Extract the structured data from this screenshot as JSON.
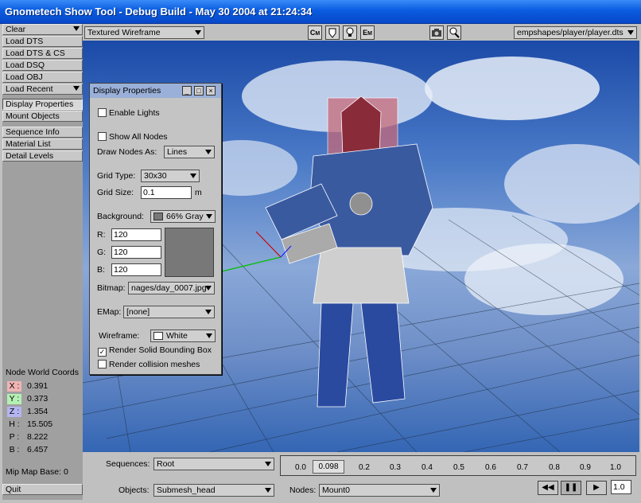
{
  "window": {
    "title": "Gnometech Show Tool - Debug Build - May 30 2004 at 21:24:34"
  },
  "left_panel": {
    "items": [
      {
        "label": "Clear",
        "has_dropdown": true
      },
      {
        "label": "Load DTS"
      },
      {
        "label": "Load DTS & CS"
      },
      {
        "label": "Load DSQ"
      },
      {
        "label": "Load OBJ"
      },
      {
        "label": "Load Recent",
        "has_dropdown": true
      },
      {
        "label": "Display Properties",
        "active": true
      },
      {
        "label": "Mount Objects"
      },
      {
        "label": "Sequence Info"
      },
      {
        "label": "Material List"
      },
      {
        "label": "Detail Levels"
      }
    ],
    "node_world_coords_title": "Node World Coords",
    "coords": [
      {
        "label": "X :",
        "value": "0.391",
        "color": "#f0b4b4"
      },
      {
        "label": "Y :",
        "value": "0.373",
        "color": "#b4f0b4"
      },
      {
        "label": "Z :",
        "value": "1.354",
        "color": "#b4b4f0"
      },
      {
        "label": "H :",
        "value": "15.505",
        "color": ""
      },
      {
        "label": "P :",
        "value": "8.222",
        "color": ""
      },
      {
        "label": "B :",
        "value": "6.457",
        "color": ""
      }
    ],
    "mip_map_base": "Mip Map Base: 0",
    "quit_label": "Quit"
  },
  "toolbar": {
    "render_mode": "Textured Wireframe",
    "icons": [
      "CM",
      "shield",
      "bulb",
      "EM",
      "camera",
      "bulb-cursor"
    ],
    "shape_path": "empshapes/player/player.dts"
  },
  "display_properties": {
    "title": "Display Properties",
    "enable_lights": "Enable Lights",
    "show_all_nodes": "Show All Nodes",
    "draw_nodes_as_label": "Draw Nodes As:",
    "draw_nodes_as_value": "Lines",
    "grid_type_label": "Grid Type:",
    "grid_type_value": "30x30",
    "grid_size_label": "Grid Size:",
    "grid_size_value": "0.1",
    "grid_size_unit": "m",
    "background_label": "Background:",
    "background_value": "66% Gray",
    "r_label": "R:",
    "r_value": "120",
    "g_label": "G:",
    "g_value": "120",
    "b_label": "B:",
    "b_value": "120",
    "bitmap_label": "Bitmap:",
    "bitmap_value": "nages/day_0007.jpg",
    "emap_label": "EMap:",
    "emap_value": "[none]",
    "wireframe_label": "Wireframe:",
    "wireframe_value": "White",
    "render_solid_bbox": "Render Solid Bounding Box",
    "render_solid_bbox_checked": true,
    "render_collision": "Render collision meshes"
  },
  "bottom": {
    "sequences_label": "Sequences:",
    "sequences_value": "Root",
    "objects_label": "Objects:",
    "objects_value": "Submesh_head",
    "nodes_label": "Nodes:",
    "nodes_value": "Mount0",
    "timeline_ticks": [
      "0.0",
      "0.098",
      "0.2",
      "0.3",
      "0.4",
      "0.5",
      "0.6",
      "0.7",
      "0.8",
      "0.9",
      "1.0"
    ],
    "current_time": "0.098",
    "speed_value": "1.0"
  }
}
